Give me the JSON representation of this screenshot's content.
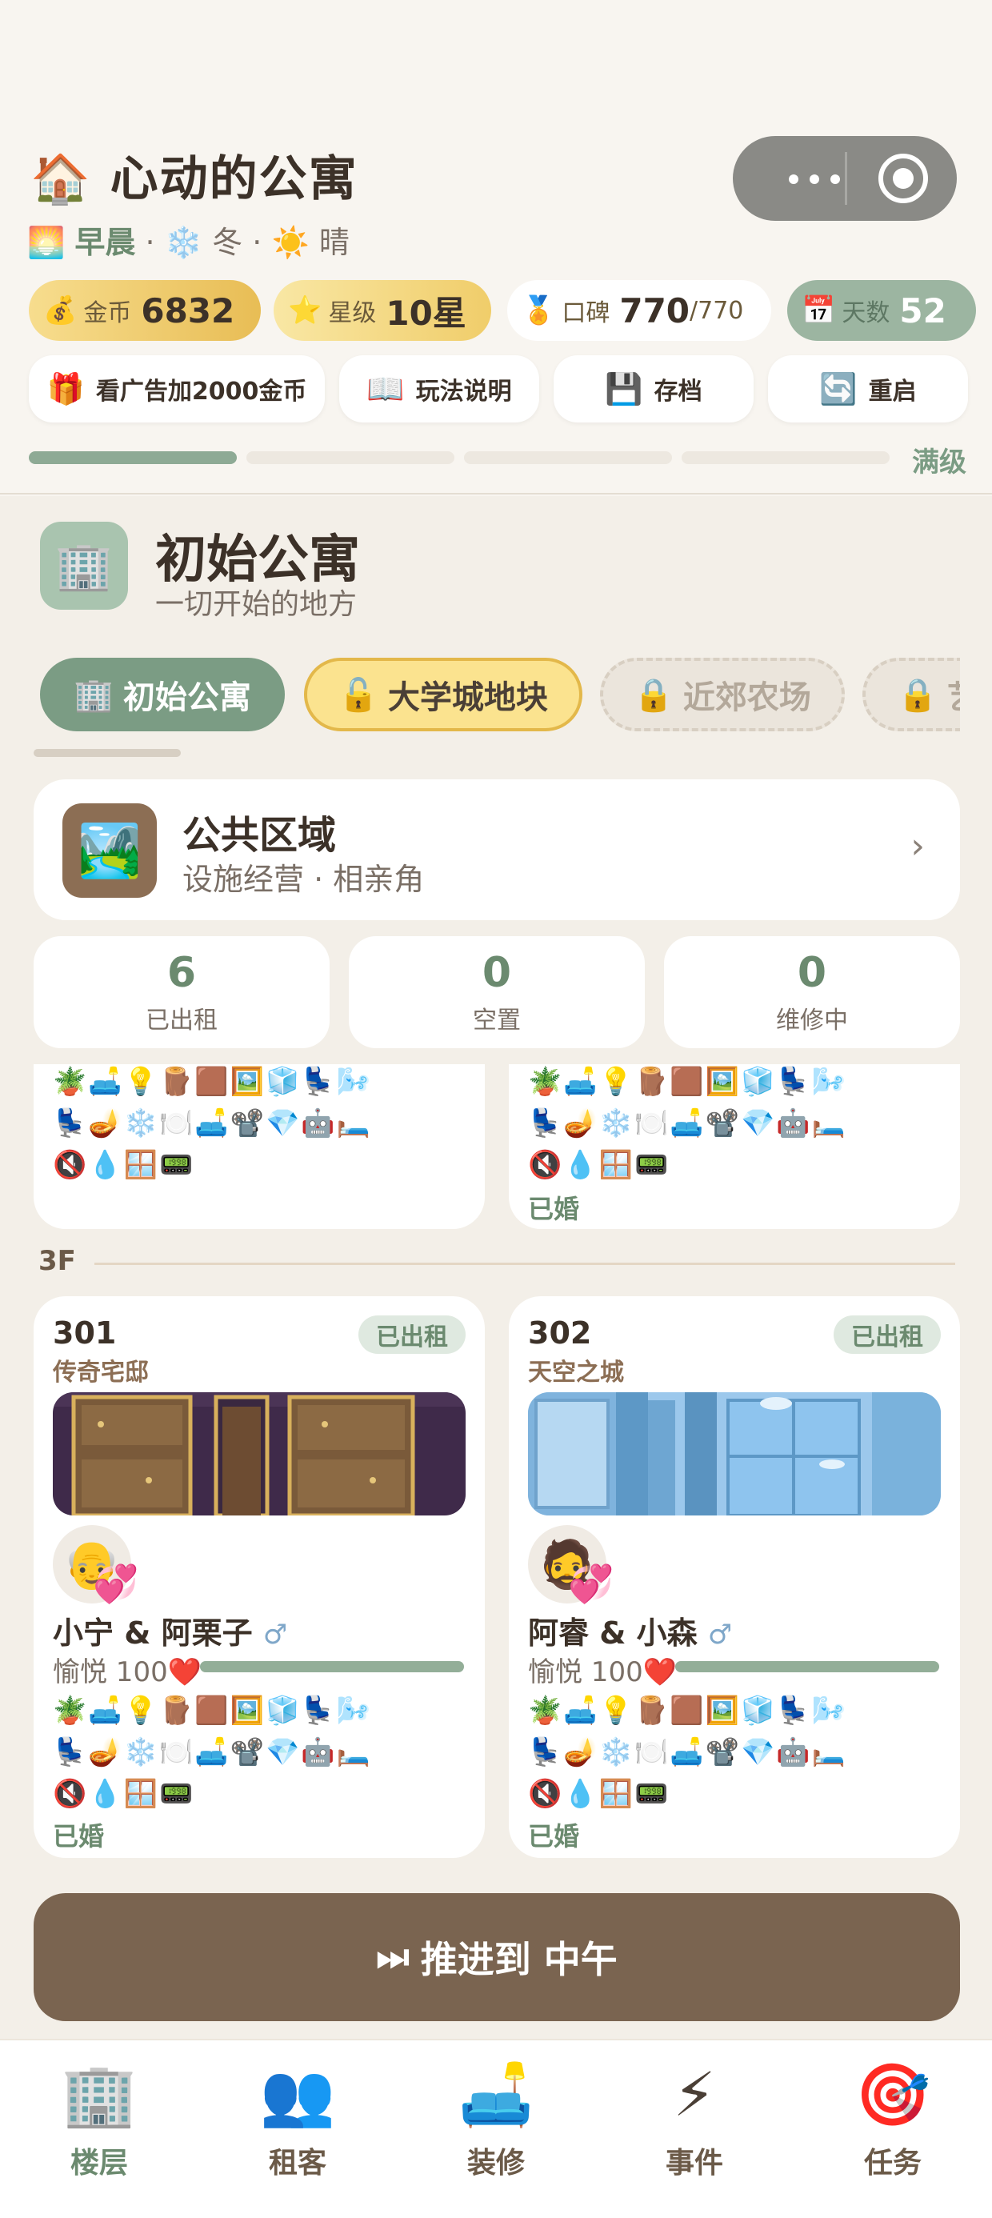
{
  "header": {
    "title_icon": "🏠",
    "title": "心动的公寓",
    "time_icon": "🌅",
    "time_of_day": "早晨",
    "sep": "·",
    "season_icon": "❄️",
    "season": "冬",
    "weather_icon": "☀️",
    "weather": "晴"
  },
  "stats": {
    "gold": {
      "icon": "💰",
      "label": "金币",
      "value": "6832"
    },
    "star": {
      "icon": "⭐",
      "label": "星级",
      "value": "10星"
    },
    "reputation": {
      "icon": "🏅",
      "label": "口碑",
      "value": "770",
      "max": "/770"
    },
    "days": {
      "icon": "📅",
      "label": "天数",
      "value": "52"
    }
  },
  "actions": {
    "ad": {
      "icon": "🎁",
      "label": "看广告加2000金币"
    },
    "help": {
      "icon": "📖",
      "label": "玩法说明"
    },
    "save": {
      "icon": "💾",
      "label": "存档"
    },
    "restart": {
      "icon": "🔄",
      "label": "重启"
    }
  },
  "level": {
    "label": "满级",
    "progress": 1.0
  },
  "apartment": {
    "icon": "🏢",
    "name": "初始公寓",
    "desc": "一切开始的地方"
  },
  "tabs": [
    {
      "icon": "🏢",
      "label": "初始公寓",
      "state": "active"
    },
    {
      "icon": "🔓",
      "label": "大学城地块",
      "state": "unlockable"
    },
    {
      "icon": "🔒",
      "label": "近郊农场",
      "state": "locked"
    },
    {
      "icon": "🔒",
      "label": "艺",
      "state": "locked"
    }
  ],
  "public_area": {
    "icon": "🏞️",
    "title": "公共区域",
    "subtitle": "设施经营 · 相亲角",
    "arrow": "›"
  },
  "counts": [
    {
      "value": "6",
      "label": "已出租"
    },
    {
      "value": "0",
      "label": "空置"
    },
    {
      "value": "0",
      "label": "维修中"
    }
  ],
  "emoji_rows": [
    "🪴🛋️💡🪵🟫🖼️🧊💺🌬️",
    "💺🪔❄️🍽️🛋️📽️💎🤖🛏️",
    "🔇💧🪟📟"
  ],
  "upper_cards": [
    {
      "status": ""
    },
    {
      "status": "已婚"
    }
  ],
  "floor": {
    "label": "3F"
  },
  "rooms": [
    {
      "number": "301",
      "name": "传奇宅邸",
      "badge": "已出租",
      "avatar": "👴",
      "heart": "💞",
      "couple": "小宁 & 阿栗子",
      "gender": "♂",
      "mood": "愉悦 100",
      "mood_icon": "❤️",
      "mood_value": 1.0,
      "status": "已婚"
    },
    {
      "number": "302",
      "name": "天空之城",
      "badge": "已出租",
      "avatar": "🧔",
      "heart": "💞",
      "couple": "阿睿 & 小森",
      "gender": "♂",
      "mood": "愉悦 100",
      "mood_icon": "❤️",
      "mood_value": 1.0,
      "status": "已婚"
    }
  ],
  "advance": {
    "icon": "⏭",
    "label": "推进到 中午"
  },
  "nav": [
    {
      "icon": "🏢",
      "label": "楼层",
      "active": true
    },
    {
      "icon": "👥",
      "label": "租客",
      "active": false
    },
    {
      "icon": "🛋️",
      "label": "装修",
      "active": false
    },
    {
      "icon": "⚡",
      "label": "事件",
      "active": false
    },
    {
      "icon": "🎯",
      "label": "任务",
      "active": false
    }
  ],
  "colors": {
    "accent": "#7b9c84",
    "gold": "#f3c95a",
    "brown": "#7a6450",
    "bg": "#f3efe8"
  }
}
